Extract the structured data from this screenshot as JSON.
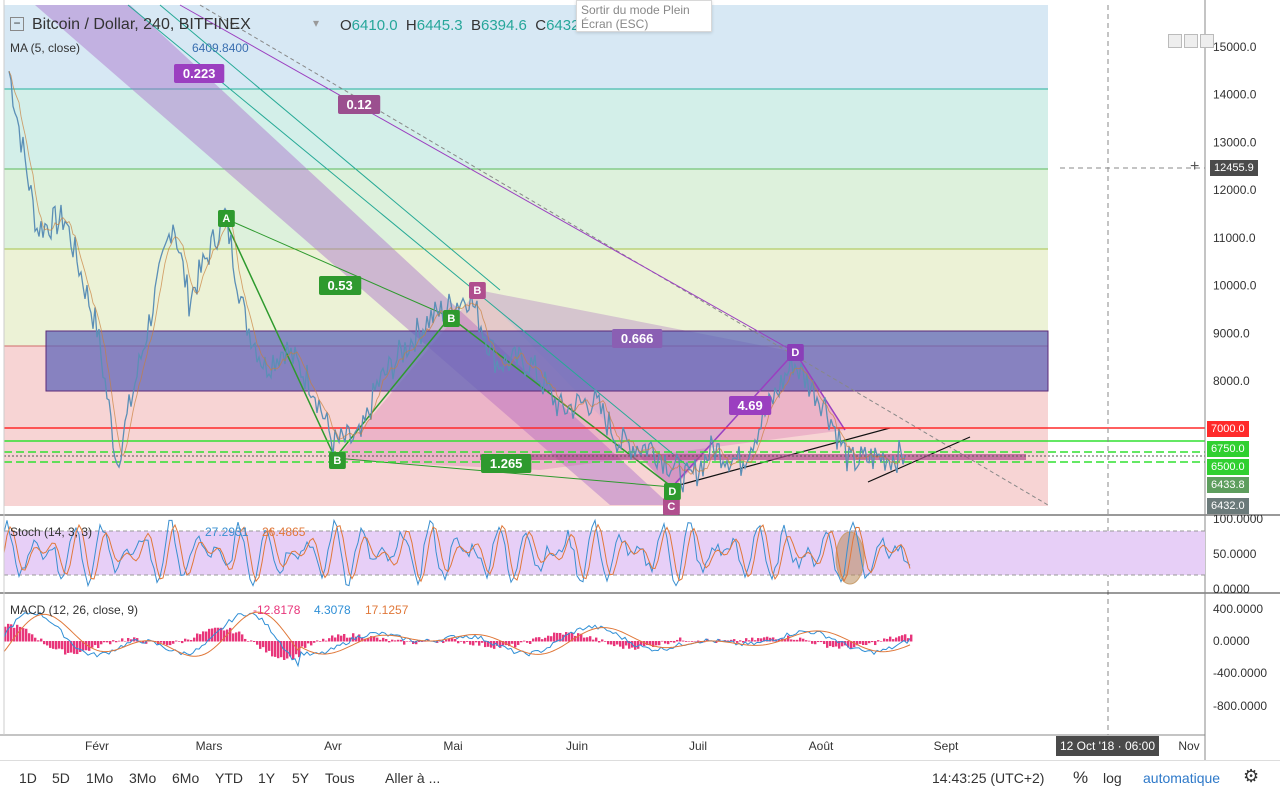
{
  "header": {
    "title": "Bitcoin / Dollar, 240, BITFINEX",
    "ohlc": [
      {
        "label": "O",
        "value": "6410.0"
      },
      {
        "label": "H",
        "value": "6445.3"
      },
      {
        "label": "B",
        "value": "6394.6"
      },
      {
        "label": "C",
        "value": "6432.0"
      }
    ],
    "ma_label": "MA (5, close)",
    "ma_value": "6409.8400"
  },
  "tooltip": {
    "line1": "Sortir du mode Plein",
    "line2": "Écran (ESC)"
  },
  "stoch": {
    "label": "Stoch (14, 3, 3)",
    "k": "27.2931",
    "d": "26.4865",
    "ticks": [
      "100.0000",
      "50.0000",
      "0.0000"
    ]
  },
  "macd": {
    "label": "MACD (12, 26, close, 9)",
    "hist": "-12.8178",
    "macd": "4.3078",
    "signal": "17.1257",
    "ticks": [
      "400.0000",
      "0.0000",
      "-400.0000",
      "-800.0000"
    ]
  },
  "price_boxes": {
    "crosshair": "12455.9",
    "red": "7000.0",
    "green1": "6750.0",
    "green2": "6500.0",
    "ma": "6433.8",
    "last": "6432.0"
  },
  "crosshair_time": "12 Oct '18 · 06:00",
  "toolbar": {
    "ranges": [
      "1D",
      "5D",
      "1Mo",
      "3Mo",
      "6Mo",
      "YTD",
      "1Y",
      "5Y",
      "Tous"
    ],
    "goto": "Aller à ...",
    "clock": "14:43:25 (UTC+2)",
    "percent": "%",
    "log": "log",
    "auto": "automatique"
  },
  "annotations": {
    "fib_a": "0.223",
    "fib_b": "0.12",
    "xabcd_ratio": "0.53",
    "xabcd_ratio2": "0.666",
    "xabcd_ratio3": "4.69",
    "xabcd_ratio4": "1.265",
    "pt_a": "A",
    "pt_b": "B",
    "pt_c": "C",
    "pt_d": "D",
    "pt_d2": "D",
    "pt_x": "B",
    "pt_x2": "B"
  },
  "colors": {
    "price_line": "#5b8fb6",
    "ma_line": "#c97f3a",
    "stoch_k": "#3a8fd0",
    "stoch_d": "#e0783a",
    "macd_line": "#2f8fd6",
    "signal_line": "#e0783a",
    "hist": "#e8357a",
    "red_level": "#ff2a2a",
    "green_level": "#30e030",
    "purple_pattern": "#9b3fc0",
    "green_pattern": "#2e9a2e"
  },
  "chart_data": {
    "type": "line",
    "title": "Bitcoin / Dollar, 240, BITFINEX",
    "x_ticks": [
      "Févr",
      "Mars",
      "Avr",
      "Mai",
      "Juin",
      "Juil",
      "Août",
      "Sept",
      "Nov"
    ],
    "y_ticks": [
      15000,
      14000,
      13000,
      12000,
      11000,
      10000,
      9000,
      8000
    ],
    "ylim": [
      6100,
      16000
    ],
    "series": [
      {
        "name": "Bitcoin / Dollar",
        "points": [
          [
            "Jan 10",
            14500
          ],
          [
            "Jan 17",
            11200
          ],
          [
            "Jan 24",
            11400
          ],
          [
            "Feb 01",
            9100
          ],
          [
            "Feb 06",
            6300
          ],
          [
            "Feb 12",
            8500
          ],
          [
            "Feb 20",
            11400
          ],
          [
            "Feb 24",
            9700
          ],
          [
            "Mar 05",
            11500
          ],
          [
            "Mar 10",
            9300
          ],
          [
            "Mar 15",
            8300
          ],
          [
            "Mar 20",
            8700
          ],
          [
            "Mar 27",
            7900
          ],
          [
            "Apr 01",
            6700
          ],
          [
            "Apr 08",
            6800
          ],
          [
            "Apr 12",
            7900
          ],
          [
            "Apr 20",
            8800
          ],
          [
            "Apr 25",
            9300
          ],
          [
            "May 05",
            9800
          ],
          [
            "May 12",
            8400
          ],
          [
            "May 20",
            8400
          ],
          [
            "May 28",
            7400
          ],
          [
            "Jun 05",
            7600
          ],
          [
            "Jun 12",
            6700
          ],
          [
            "Jun 20",
            6600
          ],
          [
            "Jun 29",
            5900
          ],
          [
            "Jul 05",
            6600
          ],
          [
            "Jul 12",
            6300
          ],
          [
            "Jul 18",
            7300
          ],
          [
            "Jul 25",
            8400
          ],
          [
            "Aug 02",
            7500
          ],
          [
            "Aug 08",
            6300
          ],
          [
            "Aug 15",
            6400
          ],
          [
            "Aug 22",
            6432
          ]
        ]
      }
    ]
  }
}
